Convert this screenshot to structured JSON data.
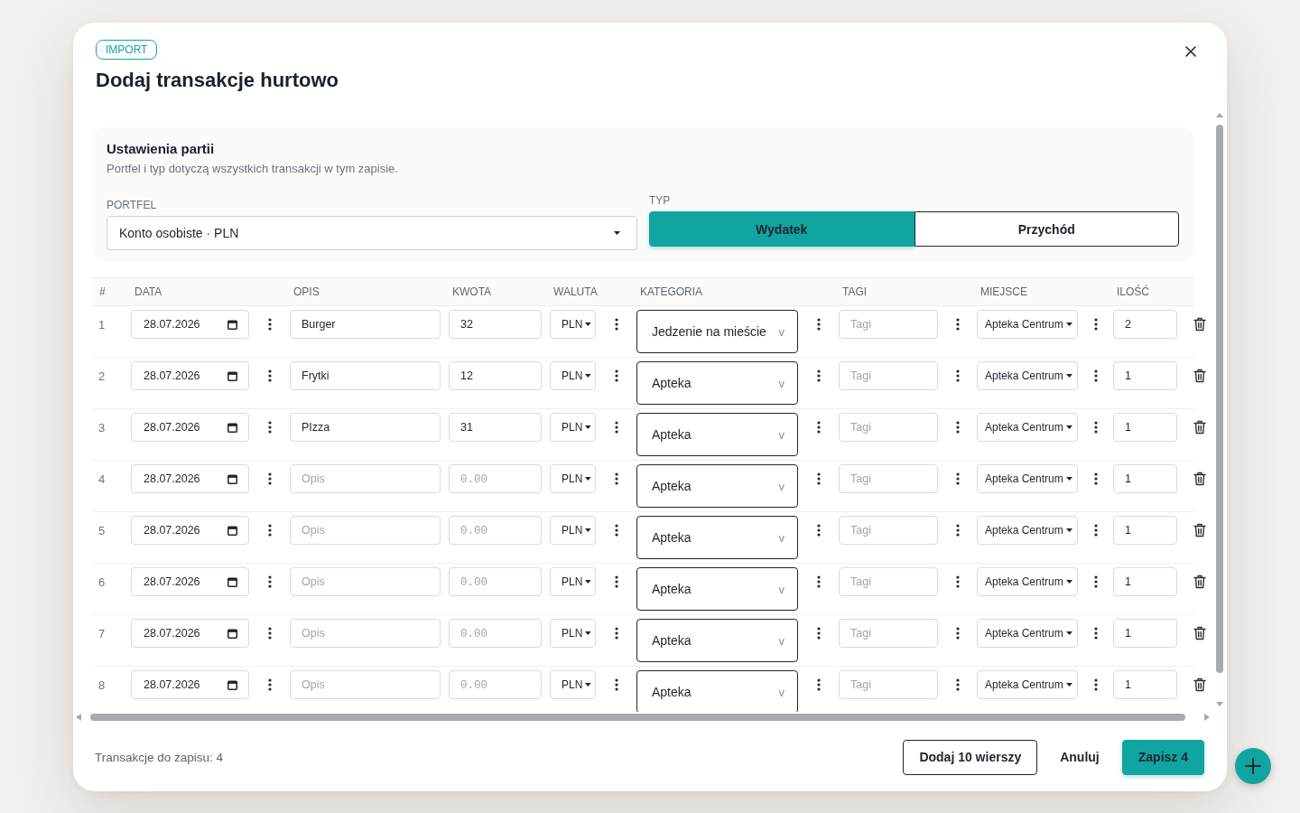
{
  "dialog": {
    "badge": "IMPORT",
    "title": "Dodaj transakcje hurtowo"
  },
  "batch_settings": {
    "title": "Ustawienia partii",
    "subtitle": "Portfel i typ dotyczą wszystkich transakcji w tym zapisie.",
    "wallet": {
      "label": "PORTFEL",
      "value": "Konto osobiste · PLN"
    },
    "type": {
      "label": "TYP",
      "options": [
        {
          "label": "Wydatek",
          "selected": true
        },
        {
          "label": "Przychód",
          "selected": false
        }
      ]
    }
  },
  "table": {
    "columns": [
      "#",
      "DATA",
      "OPIS",
      "KWOTA",
      "WALUTA",
      "KATEGORIA",
      "TAGI",
      "MIEJSCE",
      "ILOŚĆ"
    ],
    "rows": [
      {
        "number": "1",
        "date": "28.07.2026",
        "description": "Burger",
        "amount": "32",
        "currency": "PLN",
        "category": "Jedzenie na mieście",
        "category_caret": "v",
        "tags_placeholder": "Tagi",
        "place": "Apteka Centrum",
        "quantity": "2"
      },
      {
        "number": "2",
        "date": "28.07.2026",
        "description": "Frytki",
        "amount": "12",
        "currency": "PLN",
        "category": "Apteka",
        "category_caret": "v",
        "tags_placeholder": "Tagi",
        "place": "Apteka Centrum",
        "quantity": "1"
      },
      {
        "number": "3",
        "date": "28.07.2026",
        "description": "PIzza",
        "amount": "31",
        "currency": "PLN",
        "category": "Apteka",
        "category_caret": "v",
        "tags_placeholder": "Tagi",
        "place": "Apteka Centrum",
        "quantity": "1"
      },
      {
        "number": "4",
        "date": "28.07.2026",
        "description_placeholder": "Opis",
        "amount_placeholder": "0.00",
        "currency": "PLN",
        "category": "Apteka",
        "category_caret": "v",
        "tags_placeholder": "Tagi",
        "place": "Apteka Centrum",
        "quantity": "1"
      },
      {
        "number": "5",
        "date": "28.07.2026",
        "description_placeholder": "Opis",
        "amount_placeholder": "0.00",
        "currency": "PLN",
        "category": "Apteka",
        "category_caret": "v",
        "tags_placeholder": "Tagi",
        "place": "Apteka Centrum",
        "quantity": "1"
      },
      {
        "number": "6",
        "date": "28.07.2026",
        "description_placeholder": "Opis",
        "amount_placeholder": "0.00",
        "currency": "PLN",
        "category": "Apteka",
        "category_caret": "v",
        "tags_placeholder": "Tagi",
        "place": "Apteka Centrum",
        "quantity": "1"
      },
      {
        "number": "7",
        "date": "28.07.2026",
        "description_placeholder": "Opis",
        "amount_placeholder": "0.00",
        "currency": "PLN",
        "category": "Apteka",
        "category_caret": "v",
        "tags_placeholder": "Tagi",
        "place": "Apteka Centrum",
        "quantity": "1"
      },
      {
        "number": "8",
        "date": "28.07.2026",
        "description_placeholder": "Opis",
        "amount_placeholder": "0.00",
        "currency": "PLN",
        "category": "Apteka",
        "category_caret": "v",
        "tags_placeholder": "Tagi",
        "place": "Apteka Centrum",
        "quantity": "1"
      }
    ]
  },
  "footer": {
    "summary": "Transakcje do zapisu: 4",
    "buttons": [
      {
        "label": "Dodaj 10 wierszy",
        "kind": "outline"
      },
      {
        "label": "Anuluj",
        "kind": "text"
      },
      {
        "label": "Zapisz 4",
        "kind": "primary"
      }
    ]
  }
}
